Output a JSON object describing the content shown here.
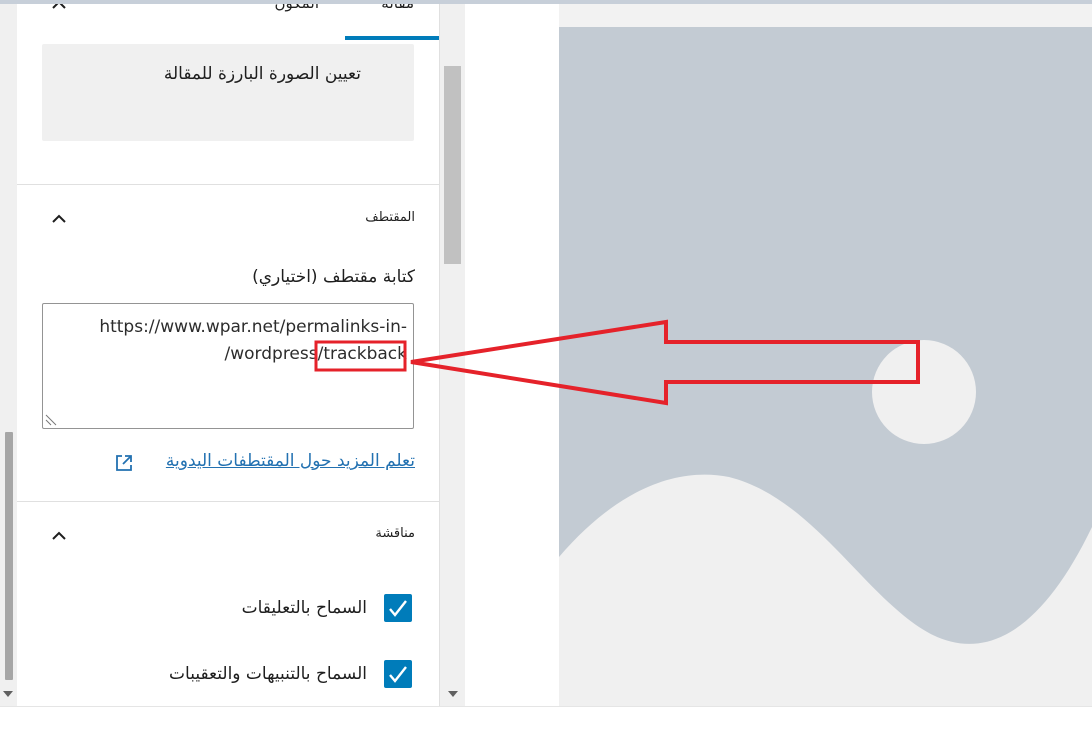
{
  "tabs": {
    "post_label": "مقالة",
    "block_label": "المكون"
  },
  "featured_image": {
    "label": "تعيين الصورة البارزة للمقالة"
  },
  "excerpt": {
    "section_title": "المقتطف",
    "field_label": "كتابة مقتطف (اختياري)",
    "value_line1": "https://www.wpar.net/permalinks-in-",
    "value_line2": "/wordpress/trackback",
    "highlighted_word": "trackback",
    "learn_more_link": "تعلم المزيد حول المقتطفات اليدوية"
  },
  "discussion": {
    "section_title": "مناقشة",
    "allow_comments": {
      "label": "السماح بالتعليقات",
      "checked": true
    },
    "allow_pingbacks": {
      "label": "السماح بالتنبيهات والتعقيبات",
      "checked": true
    }
  },
  "icons": {
    "collapse": "chevron-up-icon",
    "external": "external-link-icon",
    "check": "checkmark-icon",
    "annotation": "red-arrow-annotation"
  },
  "colors": {
    "accent": "#007cba",
    "link": "#2271b1",
    "annotation": "#e5222a",
    "placeholder_bg": "#c3cbd3"
  }
}
